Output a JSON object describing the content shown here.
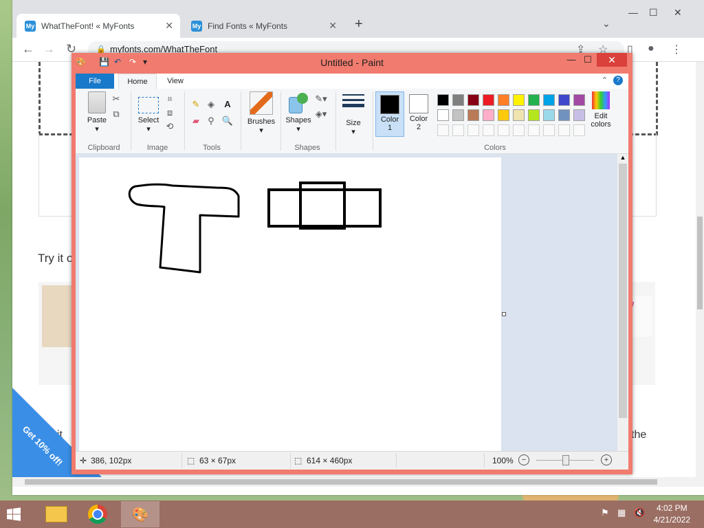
{
  "browser": {
    "tabs": [
      {
        "title": "WhatTheFont! « MyFonts",
        "active": true
      },
      {
        "title": "Find Fonts « MyFonts",
        "active": false
      }
    ],
    "favicon_text": "My",
    "url": "myfonts.com/WhatTheFont"
  },
  "page": {
    "try_text": "Try it o",
    "how_text": "ow it",
    "right_text": "the",
    "promo": "Get 10% off!"
  },
  "paint": {
    "title": "Untitled - Paint",
    "tabs": {
      "file": "File",
      "home": "Home",
      "view": "View"
    },
    "groups": {
      "clipboard": "Clipboard",
      "image": "Image",
      "tools": "Tools",
      "shapes": "Shapes",
      "colors": "Colors"
    },
    "buttons": {
      "paste": "Paste",
      "select": "Select",
      "brushes": "Brushes",
      "shapes": "Shapes",
      "size": "Size",
      "color1_line1": "Color",
      "color1_line2": "1",
      "color2_line1": "Color",
      "color2_line2": "2",
      "edit_colors_line1": "Edit",
      "edit_colors_line2": "colors"
    },
    "palette_row1": [
      "#000000",
      "#7f7f7f",
      "#880015",
      "#ed1c24",
      "#ff7f27",
      "#fff200",
      "#22b14c",
      "#00a2e8",
      "#3f48cc",
      "#a349a4"
    ],
    "palette_row2": [
      "#ffffff",
      "#c3c3c3",
      "#b97a57",
      "#ffaec9",
      "#ffc90e",
      "#efe4b0",
      "#b5e61d",
      "#99d9ea",
      "#7092be",
      "#c8bfe7"
    ],
    "color1": "#000000",
    "color2": "#ffffff",
    "status": {
      "cursor": "386, 102px",
      "selection": "63 × 67px",
      "size": "614 × 460px",
      "zoom": "100%"
    }
  },
  "taskbar": {
    "time": "4:02 PM",
    "date": "4/21/2022"
  }
}
